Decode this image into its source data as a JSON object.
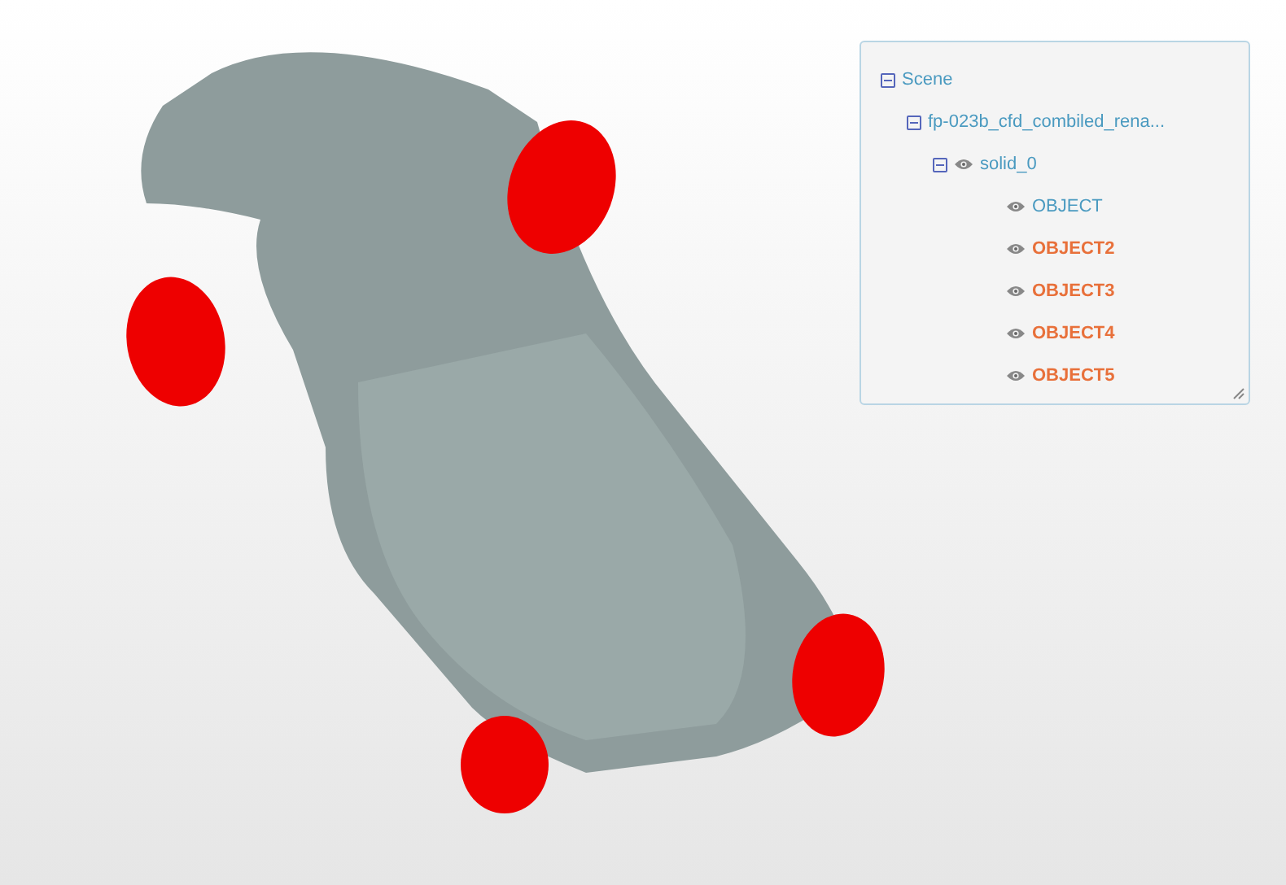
{
  "tree": {
    "items": [
      {
        "label": "Scene",
        "kind": "group",
        "expanded": true,
        "selected": false,
        "children": [
          {
            "label": "fp-023b_cfd_combiled_rena...",
            "kind": "group",
            "expanded": true,
            "selected": false,
            "children": [
              {
                "label": "solid_0",
                "kind": "mesh",
                "expanded": true,
                "selected": false,
                "children": [
                  {
                    "label": "OBJECT",
                    "kind": "mesh",
                    "selected": false
                  },
                  {
                    "label": "OBJECT2",
                    "kind": "mesh",
                    "selected": true
                  },
                  {
                    "label": "OBJECT3",
                    "kind": "mesh",
                    "selected": true
                  },
                  {
                    "label": "OBJECT4",
                    "kind": "mesh",
                    "selected": true
                  },
                  {
                    "label": "OBJECT5",
                    "kind": "mesh",
                    "selected": true
                  }
                ]
              }
            ]
          }
        ]
      }
    ]
  }
}
